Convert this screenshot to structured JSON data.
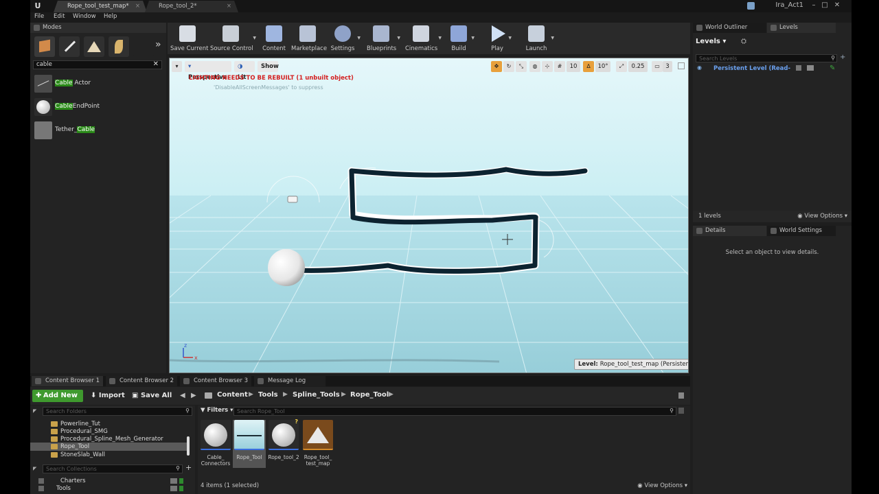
{
  "titlebar": {
    "tabs": [
      {
        "label": "Rope_tool_test_map*"
      },
      {
        "label": "Rope_tool_2*"
      }
    ],
    "project": "Ira_Act1",
    "close": "×"
  },
  "menu": [
    "File",
    "Edit",
    "Window",
    "Help"
  ],
  "modes": {
    "tab_label": "Modes",
    "search_value": "cable",
    "results": [
      {
        "prefix": "",
        "match": "Cable",
        "suffix": " Actor"
      },
      {
        "prefix": "",
        "match": "Cable",
        "suffix": "EndPoint"
      },
      {
        "prefix": "Tether_",
        "match": "Cable",
        "suffix": ""
      }
    ],
    "expand": "»"
  },
  "toolbar": {
    "buttons": [
      "Save Current",
      "Source Control",
      "Content",
      "Marketplace",
      "Settings",
      "Blueprints",
      "Cinematics",
      "Build",
      "Play",
      "Launch"
    ]
  },
  "viewport": {
    "perspective": "Perspective",
    "lit": "Lit",
    "show": "Show",
    "warning": "LIGHTING NEEDS TO BE REBUILT (1 unbuilt object)",
    "suppress": "'DisableAllScreenMessages' to suppress",
    "grid_snap": "10",
    "rot_snap": "10°",
    "scale_snap": "0.25",
    "cam_speed": "3",
    "level_label": "Level:",
    "level_name": "Rope_tool_test_map (Persistent)",
    "colors": {
      "sky_top": "#c9eef3",
      "floor": "#9fd3de",
      "rope": "#0c2330"
    }
  },
  "outliner": {
    "tab_outliner": "World Outliner",
    "tab_levels": "Levels",
    "levels_dropdown": "Levels",
    "search_placeholder": "Search Levels",
    "persistent": "Persistent Level (Read-",
    "count": "1 levels",
    "view_options": "View Options"
  },
  "details": {
    "tab_details": "Details",
    "tab_world": "World Settings",
    "empty": "Select an object to view details."
  },
  "content_browser": {
    "tabs": [
      "Content Browser 1",
      "Content Browser 2",
      "Content Browser 3",
      "Message Log"
    ],
    "add_new": "Add New",
    "import": "Import",
    "save_all": "Save All",
    "breadcrumb": [
      "Content",
      "Tools",
      "Spline_Tools",
      "Rope_Tool"
    ],
    "search_folders": "Search Folders",
    "folders": [
      "Powerline_Tut",
      "Procedural_SMG",
      "Procedural_Spline_Mesh_Generator",
      "Rope_Tool",
      "StoneSlab_Wall"
    ],
    "search_collections": "Search Collections",
    "collections": [
      "Charters",
      "Tools"
    ],
    "filters": "Filters",
    "search_assets": "Search Rope_Tool",
    "assets": [
      {
        "name": "Cable_\nConnectors"
      },
      {
        "name": "Rope_Tool"
      },
      {
        "name": "Rope_tool_2"
      },
      {
        "name": "Rope_tool_\ntest_map"
      }
    ],
    "status": "4 items (1 selected)",
    "view_options": "View Options"
  }
}
